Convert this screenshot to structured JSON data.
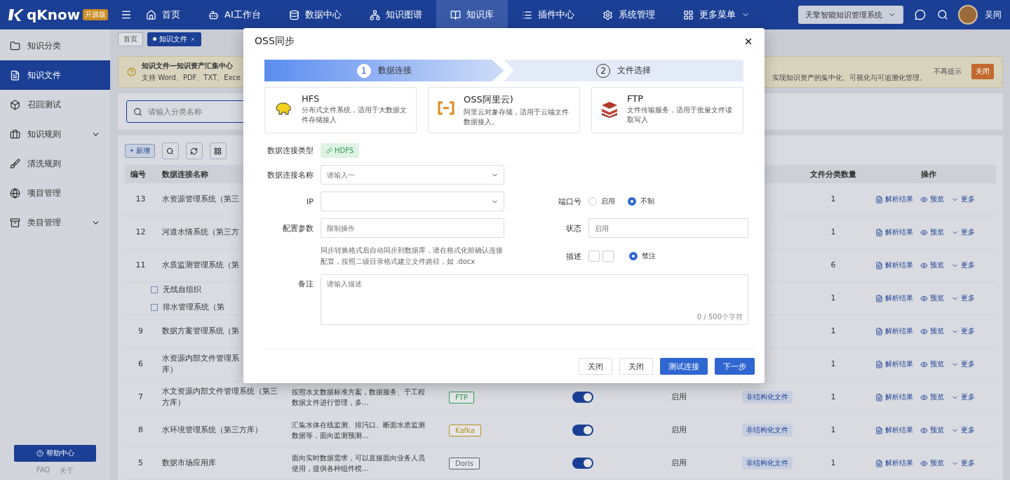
{
  "topbar": {
    "logo": "qKnow",
    "badge": "开源版",
    "nav": [
      {
        "label": "首页",
        "selected": false
      },
      {
        "label": "AI工作台",
        "selected": false
      },
      {
        "label": "数据中心",
        "selected": false
      },
      {
        "label": "知识图谱",
        "selected": false
      },
      {
        "label": "知识库",
        "selected": true
      },
      {
        "label": "插件中心",
        "selected": false
      },
      {
        "label": "系统管理",
        "selected": false
      },
      {
        "label": "更多菜单",
        "selected": false
      }
    ],
    "system_select": "天擎智能知识管理系统",
    "user": "吴同"
  },
  "sidebar": {
    "items": [
      {
        "label": "知识分类",
        "selected": false,
        "expandable": false
      },
      {
        "label": "知识文件",
        "selected": true,
        "expandable": false
      },
      {
        "label": "召回测试",
        "selected": false,
        "expandable": false
      },
      {
        "label": "知识规则",
        "selected": false,
        "expandable": true
      },
      {
        "label": "清洗规则",
        "selected": false,
        "expandable": false
      },
      {
        "label": "项目管理",
        "selected": false,
        "expandable": false
      },
      {
        "label": "类目管理",
        "selected": false,
        "expandable": true
      }
    ],
    "help_button": "帮助中心",
    "footer_links": [
      "FAQ",
      "关于"
    ]
  },
  "tabs": [
    {
      "label": "首页",
      "selected": false
    },
    {
      "label": "知识文件",
      "selected": true
    }
  ],
  "notice": {
    "title": "知识文件—知识资产汇集中心",
    "line_left": "支持 Word、PDF、TXT、Exce",
    "line_right": "实现知识资产的集中化、可视化与可追溯化管理。",
    "dismiss": "不再提示",
    "close": "关闭"
  },
  "search": {
    "placeholder": "请输入分类名称"
  },
  "add_button": "+ 新增",
  "table": {
    "columns": [
      {
        "label": "编号"
      },
      {
        "label": "数据连接名称"
      },
      {},
      {},
      {},
      {},
      {},
      {
        "label": "文件分类数量"
      },
      {
        "label": "操作"
      }
    ],
    "rows": [
      {
        "kind": "row",
        "no": "13",
        "name": "水资源管理系统（第三",
        "count": "1",
        "actions": [
          "解析结果",
          "预览",
          "更多"
        ]
      },
      {
        "kind": "row",
        "no": "12",
        "name": "河道水情系统（第三方",
        "count": "1",
        "actions": [
          "解析结果",
          "预览",
          "更多"
        ]
      },
      {
        "kind": "row",
        "no": "11",
        "name": "水质监测管理系统（第",
        "count": "6",
        "actions": [
          "解析结果",
          "预览",
          "更多"
        ]
      },
      {
        "kind": "group",
        "children": [
          {
            "name": "无线自组织"
          },
          {
            "name": "排水管理系统（第"
          }
        ],
        "count": "1",
        "actions": [
          "解析结果",
          "预览",
          "更多"
        ]
      },
      {
        "kind": "row",
        "no": "9",
        "name": "数据方案管理系统（第",
        "count": "1",
        "actions": [
          "解析结果",
          "预览",
          "更多"
        ]
      },
      {
        "kind": "row",
        "no": "6",
        "name": "水资源内部文件管理系",
        "name_continued": "库）",
        "count": "1",
        "actions": [
          "解析结果",
          "预览",
          "更多"
        ]
      },
      {
        "kind": "row",
        "no": "7",
        "name": "水文资源内部文件管理系统（第三方库）",
        "desc": "按照水文数据标准方案，数据服务、于工程数据文件进行管理，多…",
        "type": {
          "label": "FTP",
          "color": "#2e9e50"
        },
        "on": true,
        "status": "启用",
        "file_type": "非结构化文件",
        "count": "1",
        "actions": [
          "解析结果",
          "预览",
          "更多"
        ]
      },
      {
        "kind": "row",
        "no": "8",
        "name": "水环境管理系统（第三方库）",
        "desc": "汇集水体在线监测、排污口、断面水质监测数据等，面向监测预测…",
        "type": {
          "label": "Kafka",
          "color": "#b8901a"
        },
        "on": true,
        "status": "启用",
        "file_type": "非结构化文件",
        "count": "1",
        "actions": [
          "解析结果",
          "预览",
          "更多"
        ]
      },
      {
        "kind": "row",
        "no": "5",
        "name": "数据市场应用库",
        "desc": "面向实时数据需求，可以直接面向业务人员使用，提供各种组件模…",
        "type": {
          "label": "Doris",
          "color": "#5b6270"
        },
        "on": true,
        "status": "启用",
        "file_type": "非结构化文件",
        "count": "1",
        "actions": [
          "解析结果",
          "预览",
          "更多"
        ]
      }
    ]
  },
  "dialog": {
    "title": "OSS同步",
    "steps": [
      {
        "number": "1",
        "label": "数据连接",
        "selected": true
      },
      {
        "number": "2",
        "label": "文件选择",
        "selected": false
      }
    ],
    "sources": [
      {
        "kind": "hdfs",
        "title": "HFS",
        "desc": "分布式文件系统，适用于大数据文件存储接入"
      },
      {
        "kind": "oss",
        "title": "OSS阿里云)",
        "desc": "阿里云对象存储，适用于云端文件数据接入。"
      },
      {
        "kind": "ftp",
        "title": "FTP",
        "desc": "文件传输服务，适用于批量文件读取写入"
      }
    ],
    "type_label": "数据连接类型",
    "type_value": "HDFS",
    "name_label": "数据连接名称",
    "name_placeholder": "请输入一",
    "ip_label": "IP",
    "port_label": "端口号",
    "port_options": [
      {
        "label": "启用",
        "selected": false
      },
      {
        "label": "不制",
        "selected": true
      }
    ],
    "config_label": "配置参数",
    "config_placeholder": "限制操作",
    "config_help": "同步转换格式后自动同步到数据库，请在格式化前确认连接配置，按照二级目录格式建立文件路径，如 .docx",
    "status_label": "状态",
    "status_placeholder": "启用",
    "desc_label": "描述",
    "desc_checks": [
      {
        "checked": false
      },
      {
        "checked": false
      }
    ],
    "desc_option": {
      "label": "禁注",
      "selected": true
    },
    "remark_label": "备注",
    "remark_placeholder": "请输入描述",
    "remark_counter": "0 / 500个字符",
    "buttons": [
      {
        "label": "关闭",
        "kind": "default"
      },
      {
        "label": "关闭",
        "kind": "default"
      },
      {
        "label": "测试连接",
        "kind": "primary"
      },
      {
        "label": "下一步",
        "kind": "primary"
      }
    ]
  }
}
